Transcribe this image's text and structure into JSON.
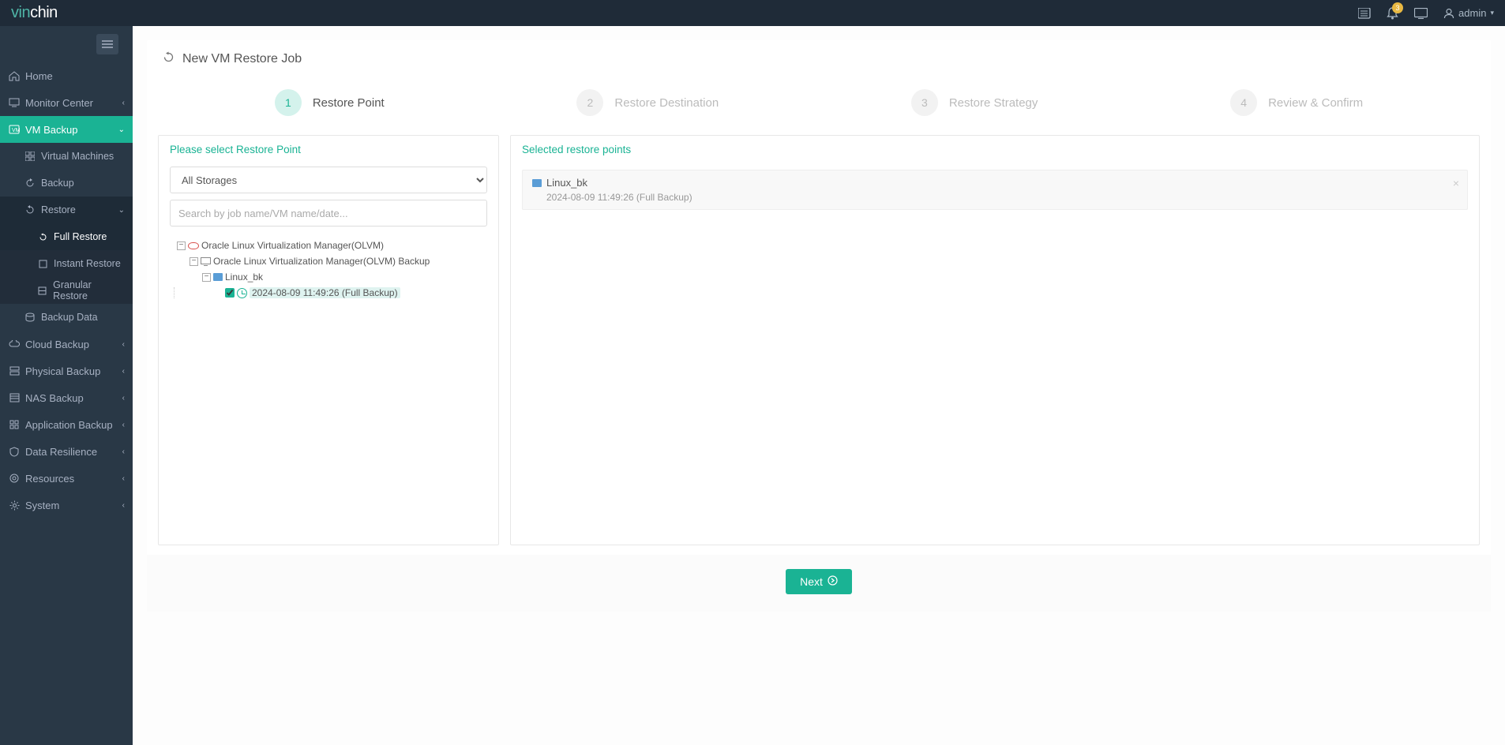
{
  "header": {
    "logo_a": "vin",
    "logo_b": "chin",
    "notif_count": "3",
    "user_label": "admin"
  },
  "sidebar": {
    "items": {
      "home": "Home",
      "monitor": "Monitor Center",
      "vmbackup": "VM Backup",
      "virtual_machines": "Virtual Machines",
      "backup": "Backup",
      "restore": "Restore",
      "full_restore": "Full Restore",
      "instant_restore": "Instant Restore",
      "granular_restore": "Granular Restore",
      "backup_data": "Backup Data",
      "cloud_backup": "Cloud Backup",
      "physical_backup": "Physical Backup",
      "nas_backup": "NAS Backup",
      "application_backup": "Application Backup",
      "data_resilience": "Data Resilience",
      "resources": "Resources",
      "system": "System"
    }
  },
  "page": {
    "title": "New VM Restore Job"
  },
  "stepper": {
    "s1": "Restore Point",
    "s2": "Restore Destination",
    "s3": "Restore Strategy",
    "s4": "Review & Confirm",
    "n1": "1",
    "n2": "2",
    "n3": "3",
    "n4": "4"
  },
  "left_panel": {
    "header": "Please select Restore Point",
    "storage_select": "All Storages",
    "search_placeholder": "Search by job name/VM name/date...",
    "tree": {
      "root": "Oracle Linux Virtualization Manager(OLVM)",
      "backup_job": "Oracle Linux Virtualization Manager(OLVM) Backup",
      "vm": "Linux_bk",
      "point": "2024-08-09 11:49:26 (Full  Backup)"
    }
  },
  "right_panel": {
    "header": "Selected restore points",
    "item_name": "Linux_bk",
    "item_detail": "2024-08-09 11:49:26 (Full Backup)"
  },
  "footer": {
    "next_label": "Next"
  },
  "colors": {
    "accent": "#1ab394"
  }
}
